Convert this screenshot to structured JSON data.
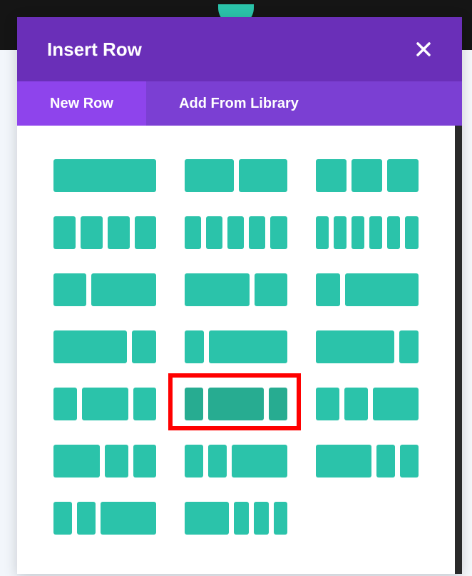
{
  "modal": {
    "title": "Insert Row",
    "close_icon": "close-icon"
  },
  "tabs": [
    {
      "label": "New Row",
      "active": true
    },
    {
      "label": "Add From Library",
      "active": false
    }
  ],
  "layouts": [
    {
      "name": "1 column",
      "columns": [
        1
      ]
    },
    {
      "name": "1/2 + 1/2",
      "columns": [
        1,
        1
      ]
    },
    {
      "name": "1/3 + 1/3 + 1/3",
      "columns": [
        1,
        1,
        1
      ]
    },
    {
      "name": "4 equal columns",
      "columns": [
        1,
        1,
        1,
        1
      ]
    },
    {
      "name": "5 equal columns",
      "columns": [
        1,
        1,
        1,
        1,
        1
      ]
    },
    {
      "name": "6 equal columns",
      "columns": [
        1,
        1,
        1,
        1,
        1,
        1
      ]
    },
    {
      "name": "1/3 + 2/3",
      "columns": [
        1,
        2
      ]
    },
    {
      "name": "2/3 + 1/3",
      "columns": [
        2,
        1
      ]
    },
    {
      "name": "1/4 + 3/4",
      "columns": [
        1,
        3
      ]
    },
    {
      "name": "3/4 + 1/4",
      "columns": [
        3,
        1
      ]
    },
    {
      "name": "1/5 + 4/5",
      "columns": [
        1,
        4
      ]
    },
    {
      "name": "4/5 + 1/5",
      "columns": [
        4,
        1
      ]
    },
    {
      "name": "1/4 + 1/2 + 1/4",
      "columns": [
        1,
        2,
        1
      ]
    },
    {
      "name": "1/5 + 3/5 + 1/5",
      "columns": [
        1,
        3,
        1
      ],
      "selected": true
    },
    {
      "name": "1/4 + 1/4 + 1/2",
      "columns": [
        1,
        1,
        2
      ]
    },
    {
      "name": "1/2 + 1/4 + 1/4",
      "columns": [
        2,
        1,
        1
      ]
    },
    {
      "name": "1/5 + 1/5 + 3/5",
      "columns": [
        1,
        1,
        3
      ]
    },
    {
      "name": "3/5 + 1/5 + 1/5",
      "columns": [
        3,
        1,
        1
      ]
    },
    {
      "name": "1/6 + 1/6 + 1/2",
      "columns": [
        1,
        1,
        3
      ]
    },
    {
      "name": "1/2 + 1/6 + 1/6 + 1/6",
      "columns": [
        3,
        1,
        1,
        1
      ]
    }
  ],
  "colors": {
    "header": "#6a2fb8",
    "tab_bar": "#7b3fd3",
    "tab_active": "#8e44ec",
    "column": "#2bc3aa",
    "column_hover": "#27ac91",
    "highlight": "#ff0000"
  }
}
